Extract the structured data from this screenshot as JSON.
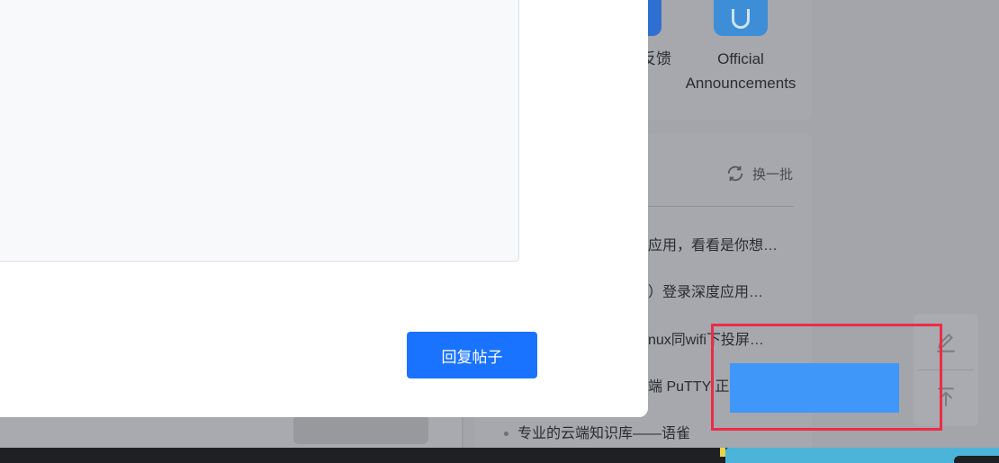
{
  "apps": {
    "feedback_label": "反馈",
    "announce_label_1": "Official",
    "announce_label_2": "Announcements"
  },
  "hot": {
    "refresh_label": "换一批",
    "items": [
      "应用，看看是你想…",
      "）登录深度应用…",
      "nux同wifi下投屏…",
      "端 PuTTY 正",
      "专业的云端知识库——语雀"
    ]
  },
  "modal": {
    "reply_button_label": "回复帖子"
  },
  "icons": {
    "edit": "pencil-icon",
    "back_to_top": "arrow-up-to-line-icon",
    "refresh": "refresh-icon",
    "announce": "v-shield-icon"
  },
  "colors": {
    "accent": "#1a73ff",
    "annotation_border": "#ee2b48",
    "annotation_fill": "#3f97f9"
  }
}
